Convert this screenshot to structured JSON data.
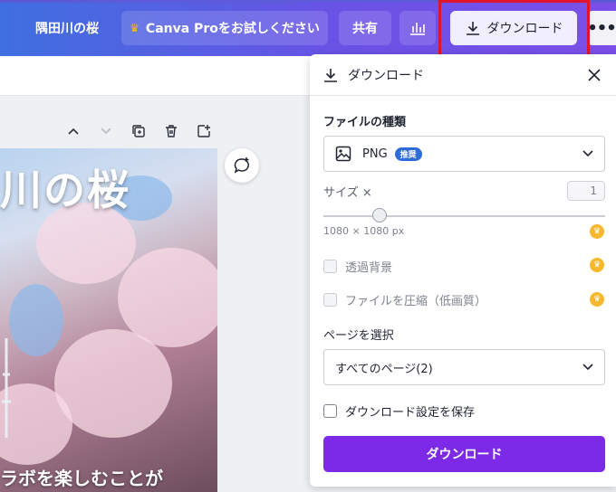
{
  "topbar": {
    "title": "隅田川の桜",
    "pro_label": "Canva Proをお試しください",
    "share_label": "共有",
    "download_label": "ダウンロード",
    "more_icon": "more-horizontal-icon"
  },
  "artwork": {
    "title_text": "川の桜",
    "bottom_text": "ラボを楽しむことが"
  },
  "panel": {
    "title": "ダウンロード",
    "file_type_label": "ファイルの種類",
    "file_type_value": "PNG",
    "recommended_badge": "推奨",
    "size_label": "サイズ ×",
    "size_value": "1",
    "size_slider_fraction": 0.2,
    "dimensions": "1080 × 1080 px",
    "transparent_bg_label": "透過背景",
    "compress_label": "ファイルを圧縮（低画質）",
    "pages_label": "ページを選択",
    "pages_value": "すべてのページ(2)",
    "save_settings_label": "ダウンロード設定を保存",
    "download_button": "ダウンロード"
  },
  "colors": {
    "accent": "#7d2ae8",
    "highlight_border": "#e0142c",
    "crown": "#f5b82e",
    "badge": "#2d6bd9"
  }
}
